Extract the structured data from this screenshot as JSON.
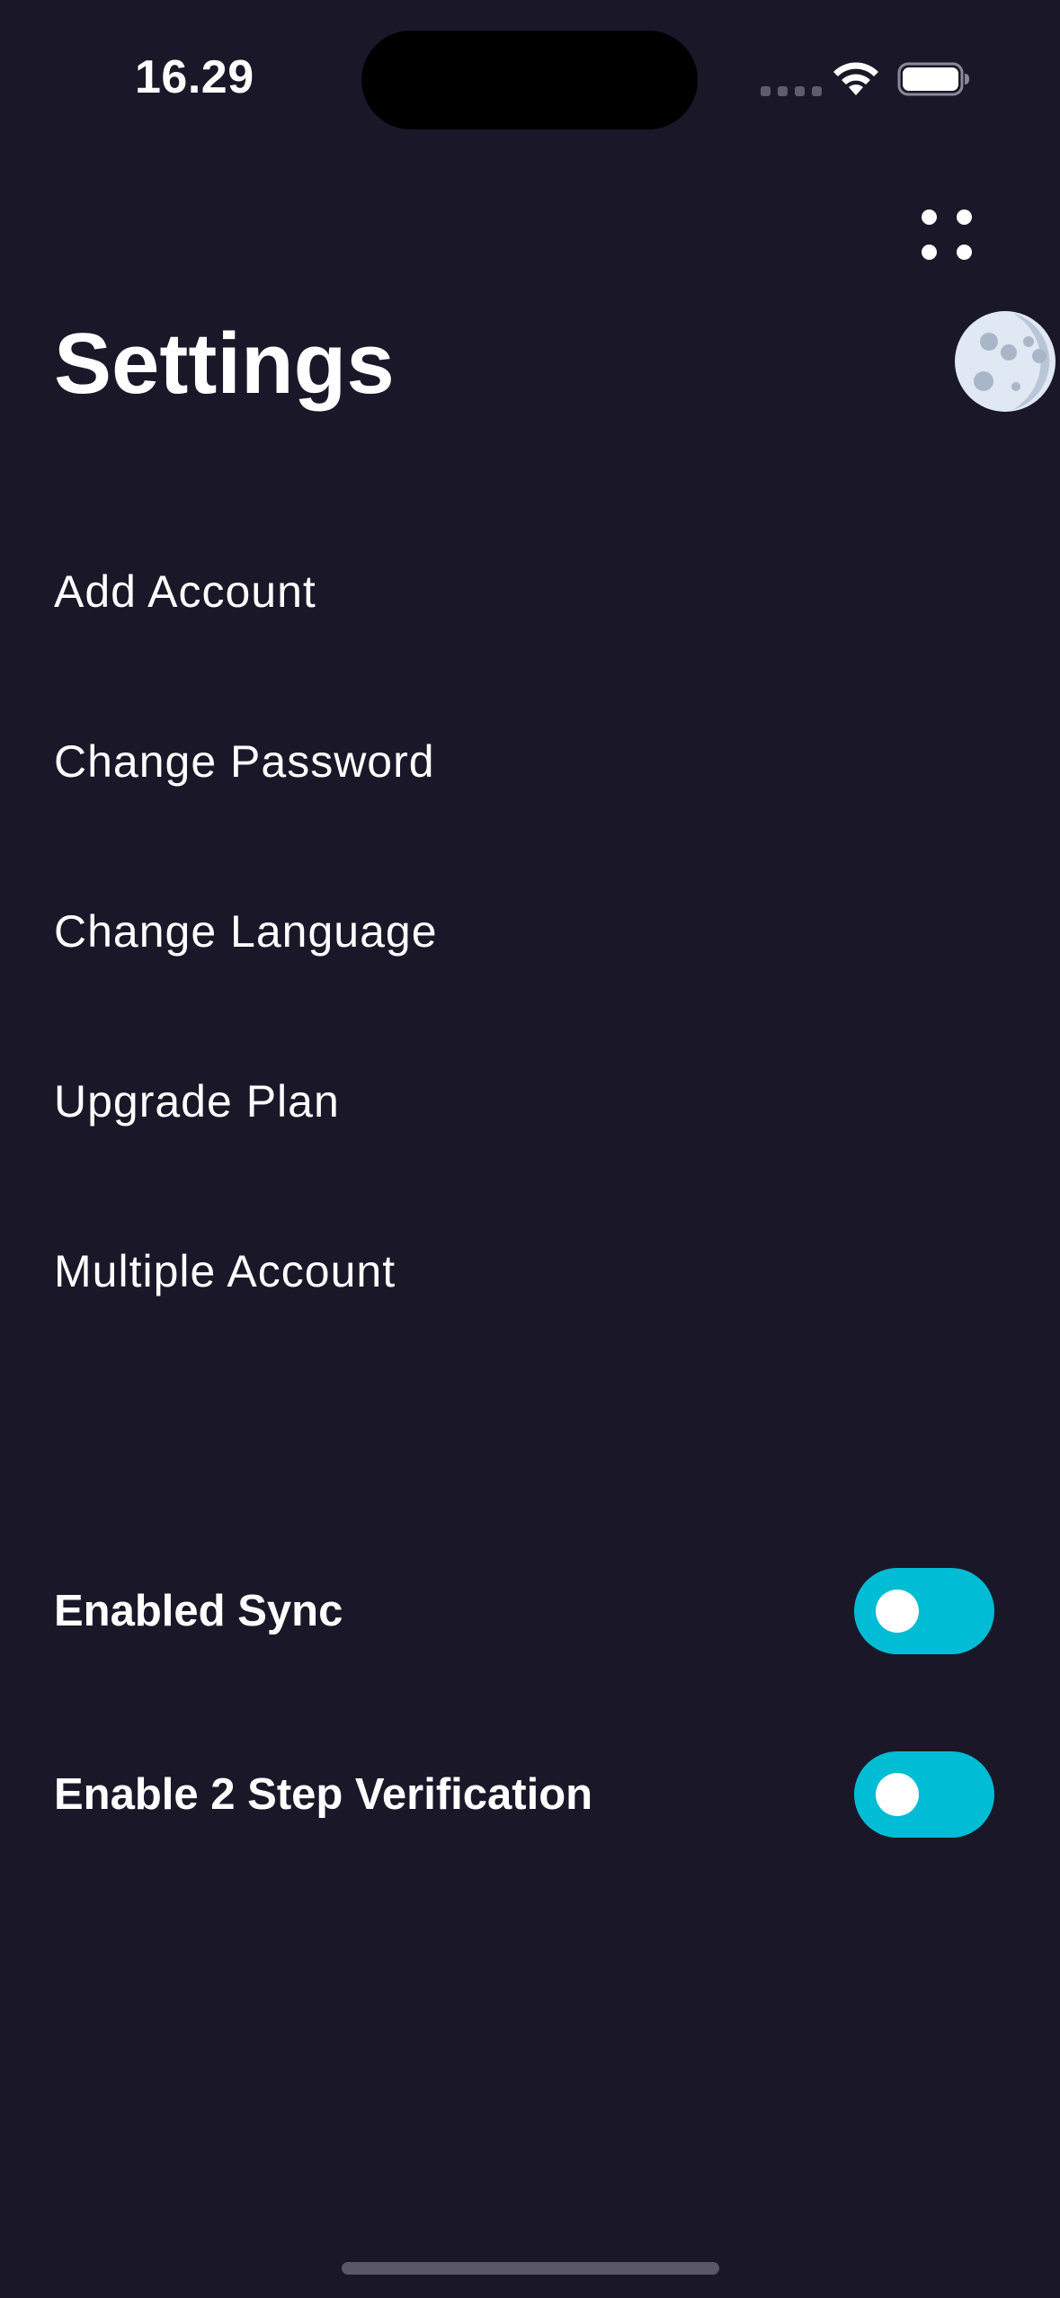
{
  "status_bar": {
    "time": "16.29"
  },
  "header": {
    "title": "Settings",
    "menu_icon": "grid-dots-icon",
    "theme_icon": "moon-icon"
  },
  "menu_items": [
    {
      "label": "Add Account"
    },
    {
      "label": "Change Password"
    },
    {
      "label": "Change Language"
    },
    {
      "label": "Upgrade Plan"
    },
    {
      "label": "Multiple Account"
    }
  ],
  "toggles": [
    {
      "label": "Enabled Sync",
      "enabled": false
    },
    {
      "label": "Enable 2 Step Verification",
      "enabled": false
    }
  ],
  "colors": {
    "background": "#1a1828",
    "accent": "#00bcd4",
    "text": "#ffffff",
    "moon": "#dfe8f3"
  }
}
